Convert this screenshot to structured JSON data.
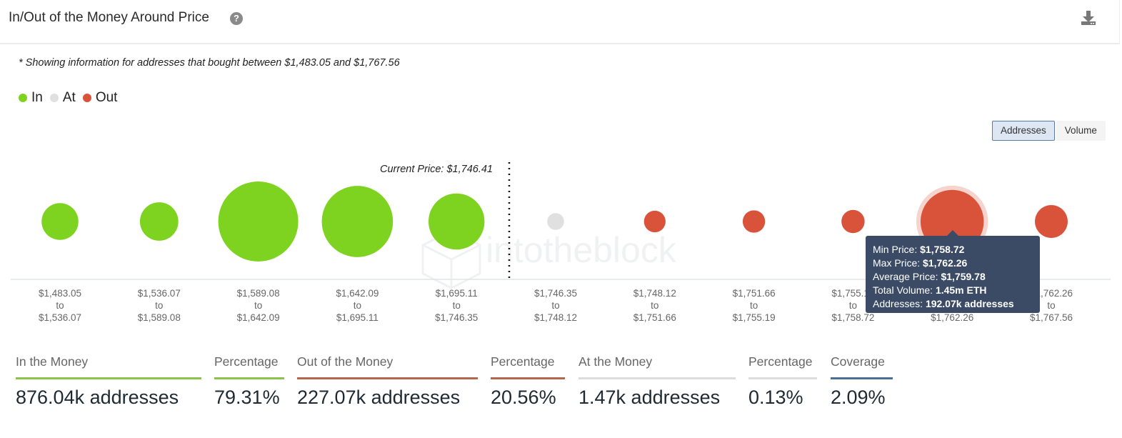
{
  "header": {
    "title": "In/Out of the Money Around Price",
    "help_icon": "question-circle-icon",
    "download_icon": "download-icon"
  },
  "note": "* Showing information for addresses that bought between $1,483.05 and $1,767.56",
  "legend": [
    {
      "label": "In",
      "color": "#7ed321"
    },
    {
      "label": "At",
      "color": "#e0e0e0"
    },
    {
      "label": "Out",
      "color": "#d9533a"
    }
  ],
  "toggle": {
    "addresses_label": "Addresses",
    "volume_label": "Volume",
    "selected": "Addresses"
  },
  "watermark": "intotheblock",
  "chart_data": {
    "type": "scatter",
    "subtype": "bubble",
    "title": "In/Out of the Money Around Price",
    "current_price_label": "Current Price: $1,746.41",
    "current_price": 1746.41,
    "categories": [
      {
        "from": "$1,483.05",
        "to": "$1,536.07",
        "status": "In",
        "relative_size": 0.46
      },
      {
        "from": "$1,536.07",
        "to": "$1,589.08",
        "status": "In",
        "relative_size": 0.48
      },
      {
        "from": "$1,589.08",
        "to": "$1,642.09",
        "status": "In",
        "relative_size": 1.0
      },
      {
        "from": "$1,642.09",
        "to": "$1,695.11",
        "status": "In",
        "relative_size": 0.89
      },
      {
        "from": "$1,695.11",
        "to": "$1,746.35",
        "status": "In",
        "relative_size": 0.7
      },
      {
        "from": "$1,746.35",
        "to": "$1,748.12",
        "status": "At",
        "relative_size": 0.21
      },
      {
        "from": "$1,748.12",
        "to": "$1,751.66",
        "status": "Out",
        "relative_size": 0.27
      },
      {
        "from": "$1,751.66",
        "to": "$1,755.19",
        "status": "Out",
        "relative_size": 0.28
      },
      {
        "from": "$1,755.19",
        "to": "$1,758.72",
        "status": "Out",
        "relative_size": 0.29
      },
      {
        "from": "$1,758.72",
        "to": "$1,762.26",
        "status": "Out",
        "relative_size": 0.79,
        "highlighted": true
      },
      {
        "from": "$1,762.26",
        "to": "$1,767.56",
        "status": "Out",
        "relative_size": 0.41
      }
    ],
    "range_connector": "to",
    "colors": {
      "In": "#7ed321",
      "At": "#e0e0e0",
      "Out": "#d9533a"
    }
  },
  "tooltip": {
    "min_label": "Min Price: ",
    "min_value": "$1,758.72",
    "max_label": "Max Price: ",
    "max_value": "$1,762.26",
    "avg_label": "Average Price: ",
    "avg_value": "$1,759.78",
    "vol_label": "Total Volume: ",
    "vol_value": "1.45m ETH",
    "addr_label": "Addresses: ",
    "addr_value": "192.07k addresses"
  },
  "stats": [
    {
      "label": "In the Money",
      "value": "876.04k addresses",
      "color": "#8bc34a"
    },
    {
      "label": "Percentage",
      "value": "79.31%",
      "color": "#8bc34a"
    },
    {
      "label": "Out of the Money",
      "value": "227.07k addresses",
      "color": "#b5664f"
    },
    {
      "label": "Percentage",
      "value": "20.56%",
      "color": "#b5664f"
    },
    {
      "label": "At the Money",
      "value": "1.47k addresses",
      "color": "#dcdcdc"
    },
    {
      "label": "Percentage",
      "value": "0.13%",
      "color": "#dcdcdc"
    },
    {
      "label": "Coverage",
      "value": "2.09%",
      "color": "#4a6f96"
    }
  ]
}
